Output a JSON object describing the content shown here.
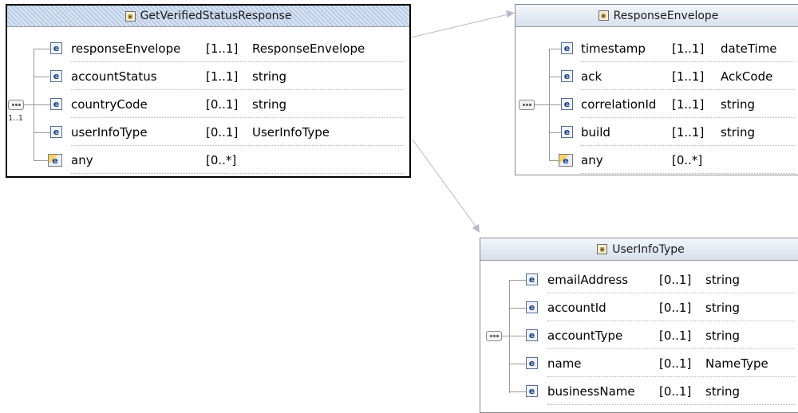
{
  "boxes": {
    "get_verified_status_response": {
      "title": "GetVerifiedStatusResponse",
      "sequence_multiplicity": "1..1",
      "rows": [
        {
          "name": "responseEnvelope",
          "mult": "[1..1]",
          "type": "ResponseEnvelope"
        },
        {
          "name": "accountStatus",
          "mult": "[1..1]",
          "type": "string"
        },
        {
          "name": "countryCode",
          "mult": "[0..1]",
          "type": "string"
        },
        {
          "name": "userInfoType",
          "mult": "[0..1]",
          "type": "UserInfoType"
        },
        {
          "name": "any",
          "mult": "[0..*]",
          "type": ""
        }
      ]
    },
    "response_envelope": {
      "title": "ResponseEnvelope",
      "rows": [
        {
          "name": "timestamp",
          "mult": "[1..1]",
          "type": "dateTime"
        },
        {
          "name": "ack",
          "mult": "[1..1]",
          "type": "AckCode"
        },
        {
          "name": "correlationId",
          "mult": "[1..1]",
          "type": "string"
        },
        {
          "name": "build",
          "mult": "[1..1]",
          "type": "string"
        },
        {
          "name": "any",
          "mult": "[0..*]",
          "type": ""
        }
      ]
    },
    "user_info_type": {
      "title": "UserInfoType",
      "rows": [
        {
          "name": "emailAddress",
          "mult": "[0..1]",
          "type": "string"
        },
        {
          "name": "accountId",
          "mult": "[0..1]",
          "type": "string"
        },
        {
          "name": "accountType",
          "mult": "[0..1]",
          "type": "string"
        },
        {
          "name": "name",
          "mult": "[0..1]",
          "type": "NameType"
        },
        {
          "name": "businessName",
          "mult": "[0..1]",
          "type": "string"
        }
      ]
    }
  },
  "icons": {
    "element_icon_glyph": "e",
    "complex_type_icon": "complex-type-icon",
    "sequence_icon": "sequence-icon",
    "any_icon": "any-element-icon"
  },
  "colors": {
    "selected_header": "#b9cbe6",
    "header": "#d8e0ec",
    "connector": "#b8b8c8"
  }
}
